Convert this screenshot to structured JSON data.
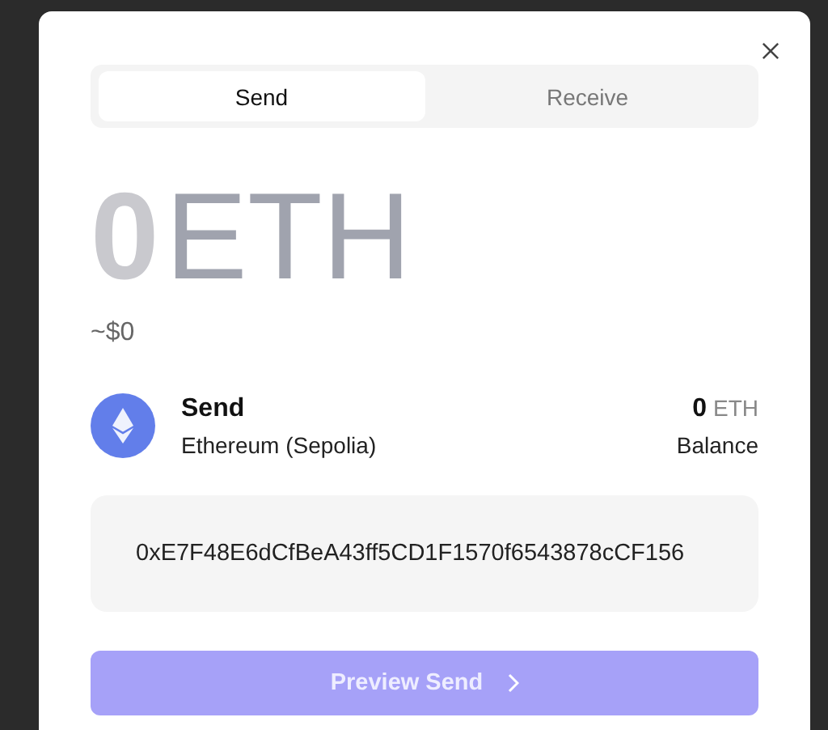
{
  "tabs": [
    {
      "label": "Send",
      "selected": true
    },
    {
      "label": "Receive",
      "selected": false
    }
  ],
  "amount": {
    "value": "0",
    "unit": "ETH",
    "fiat": "~$0"
  },
  "asset": {
    "title": "Send",
    "network": "Ethereum (Sepolia)",
    "balance": "0",
    "balance_unit": "ETH",
    "balance_label": "Balance"
  },
  "address": {
    "value": "0xE7F48E6dCfBeA43ff5CD1F1570f6543878cCF156"
  },
  "button": {
    "label": "Preview Send",
    "disabled": true
  }
}
